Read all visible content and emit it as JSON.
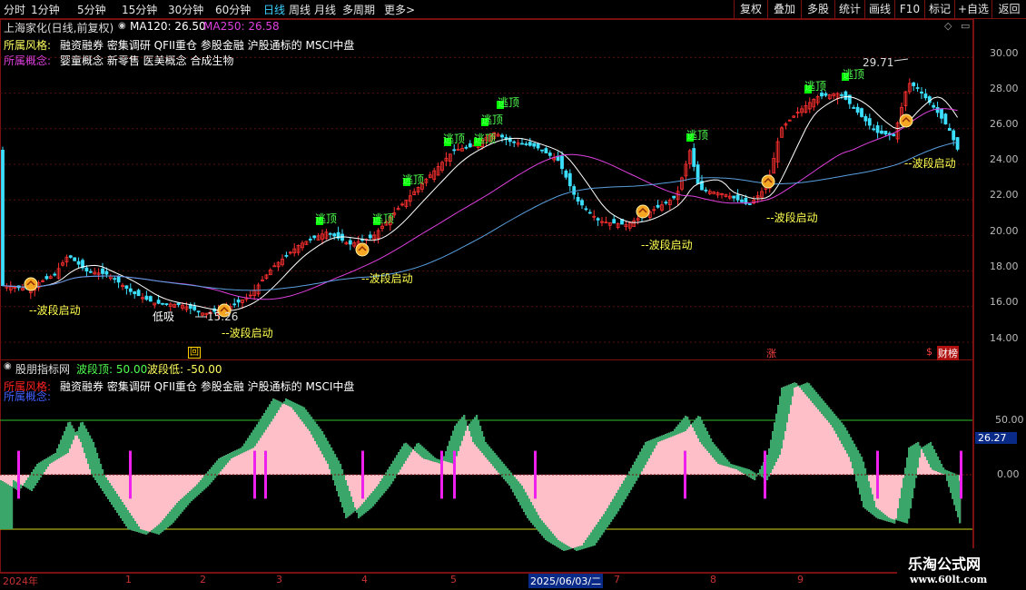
{
  "toolbar": {
    "periods": [
      "分时",
      "1分钟",
      "5分钟",
      "15分钟",
      "30分钟",
      "60分钟",
      "日线",
      "周线",
      "月线",
      "多周期",
      "更多"
    ],
    "active": "日线",
    "buttons": [
      "复权",
      "叠加",
      "多股",
      "统计",
      "画线",
      "F10",
      "标记",
      "+自选",
      "返回"
    ]
  },
  "main_header": {
    "title": "上海家化(日线,前复权)",
    "ma120": "MA120: 26.50",
    "ma250": "MA250: 26.58",
    "style_label": "所属风格:",
    "style_value": "融资融券 密集调研 QFII重仓 参股金融 沪股通标的 MSCI中盘",
    "concept_label": "所属概念:",
    "concept_value": "婴童概念 新零售 医美概念 合成生物"
  },
  "sub_header": {
    "title": "股朋指标网",
    "top": "波段顶: 50.00",
    "low": "波段低: -50.00",
    "style_label": "所属风格:",
    "style_value": "融资融券 密集调研 QFII重仓 参股金融 沪股通标的 MSCI中盘",
    "concept_label": "所属概念:"
  },
  "price_axis": [
    "30.00",
    "28.00",
    "26.00",
    "24.00",
    "22.00",
    "20.00",
    "18.00",
    "16.00",
    "14.00"
  ],
  "osc_axis": [
    "50.00",
    "0.00",
    "26.27"
  ],
  "date_axis": [
    "2024年",
    "1",
    "2",
    "3",
    "4",
    "5",
    "2025/06/03/二",
    "7",
    "8",
    "9"
  ],
  "annotations": {
    "escape": "逃顶",
    "launch": "--波段启动",
    "high": "29.71",
    "low": "15.26",
    "buy": "低吸",
    "zhang": "涨",
    "hui": "回",
    "cai": "财",
    "bang": "榜"
  },
  "watermark": {
    "cn": "乐淘公式网",
    "url": "www.60lt.com"
  },
  "colors": {
    "up": "#ff3030",
    "down": "#3ce0ff",
    "ma_white": "#ffffff",
    "ma_magenta": "#e040e0",
    "ma_blue": "#5aa0e0",
    "osc_pink": "#ffbfc8",
    "osc_green": "#3aa66a",
    "signal_bar": "#ee20ee",
    "escape_green": "#00ff00",
    "label_yellow": "#ffff50"
  },
  "chart_data": {
    "type": "candlestick",
    "ylim": [
      13.5,
      30.8
    ],
    "y_ticks": [
      14,
      16,
      18,
      20,
      22,
      24,
      26,
      28,
      30
    ],
    "high": 29.71,
    "low": 15.26,
    "osc_levels": {
      "top": 50,
      "zero": 0,
      "low": -50
    },
    "osc_current": 26.27
  }
}
